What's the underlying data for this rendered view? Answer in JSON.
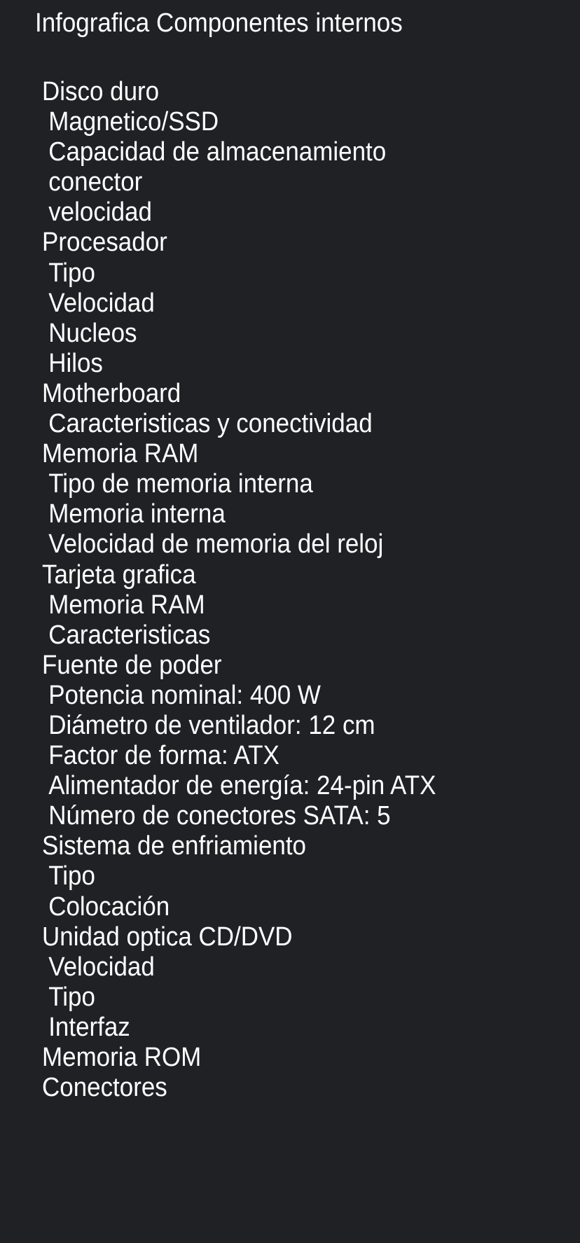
{
  "title": "Infografica Componentes internos",
  "sections": [
    {
      "label": "Disco duro",
      "items": [
        "Magnetico/SSD",
        "Capacidad de almacenamiento",
        "conector",
        "velocidad"
      ]
    },
    {
      "label": "Procesador",
      "items": [
        "Tipo",
        "Velocidad",
        "Nucleos",
        "Hilos"
      ]
    },
    {
      "label": "Motherboard",
      "items": [
        "Caracteristicas y conectividad"
      ]
    },
    {
      "label": "Memoria RAM",
      "items": [
        "Tipo de memoria interna",
        "Memoria interna",
        "Velocidad de memoria del reloj"
      ]
    },
    {
      "label": "Tarjeta grafica",
      "items": [
        "Memoria RAM",
        "Caracteristicas"
      ]
    },
    {
      "label": "Fuente de poder",
      "items": [
        "Potencia nominal: 400 W",
        "Diámetro de ventilador: 12 cm",
        "Factor de forma: ATX",
        "Alimentador de energía: 24-pin ATX",
        "Número de conectores SATA: 5"
      ]
    },
    {
      "label": "Sistema de enfriamiento",
      "items": [
        "Tipo",
        "Colocación"
      ]
    },
    {
      "label": "Unidad optica CD/DVD",
      "items": [
        "Velocidad",
        "Tipo",
        "Interfaz"
      ]
    },
    {
      "label": "Memoria ROM",
      "items": []
    },
    {
      "label": "Conectores",
      "items": []
    }
  ]
}
